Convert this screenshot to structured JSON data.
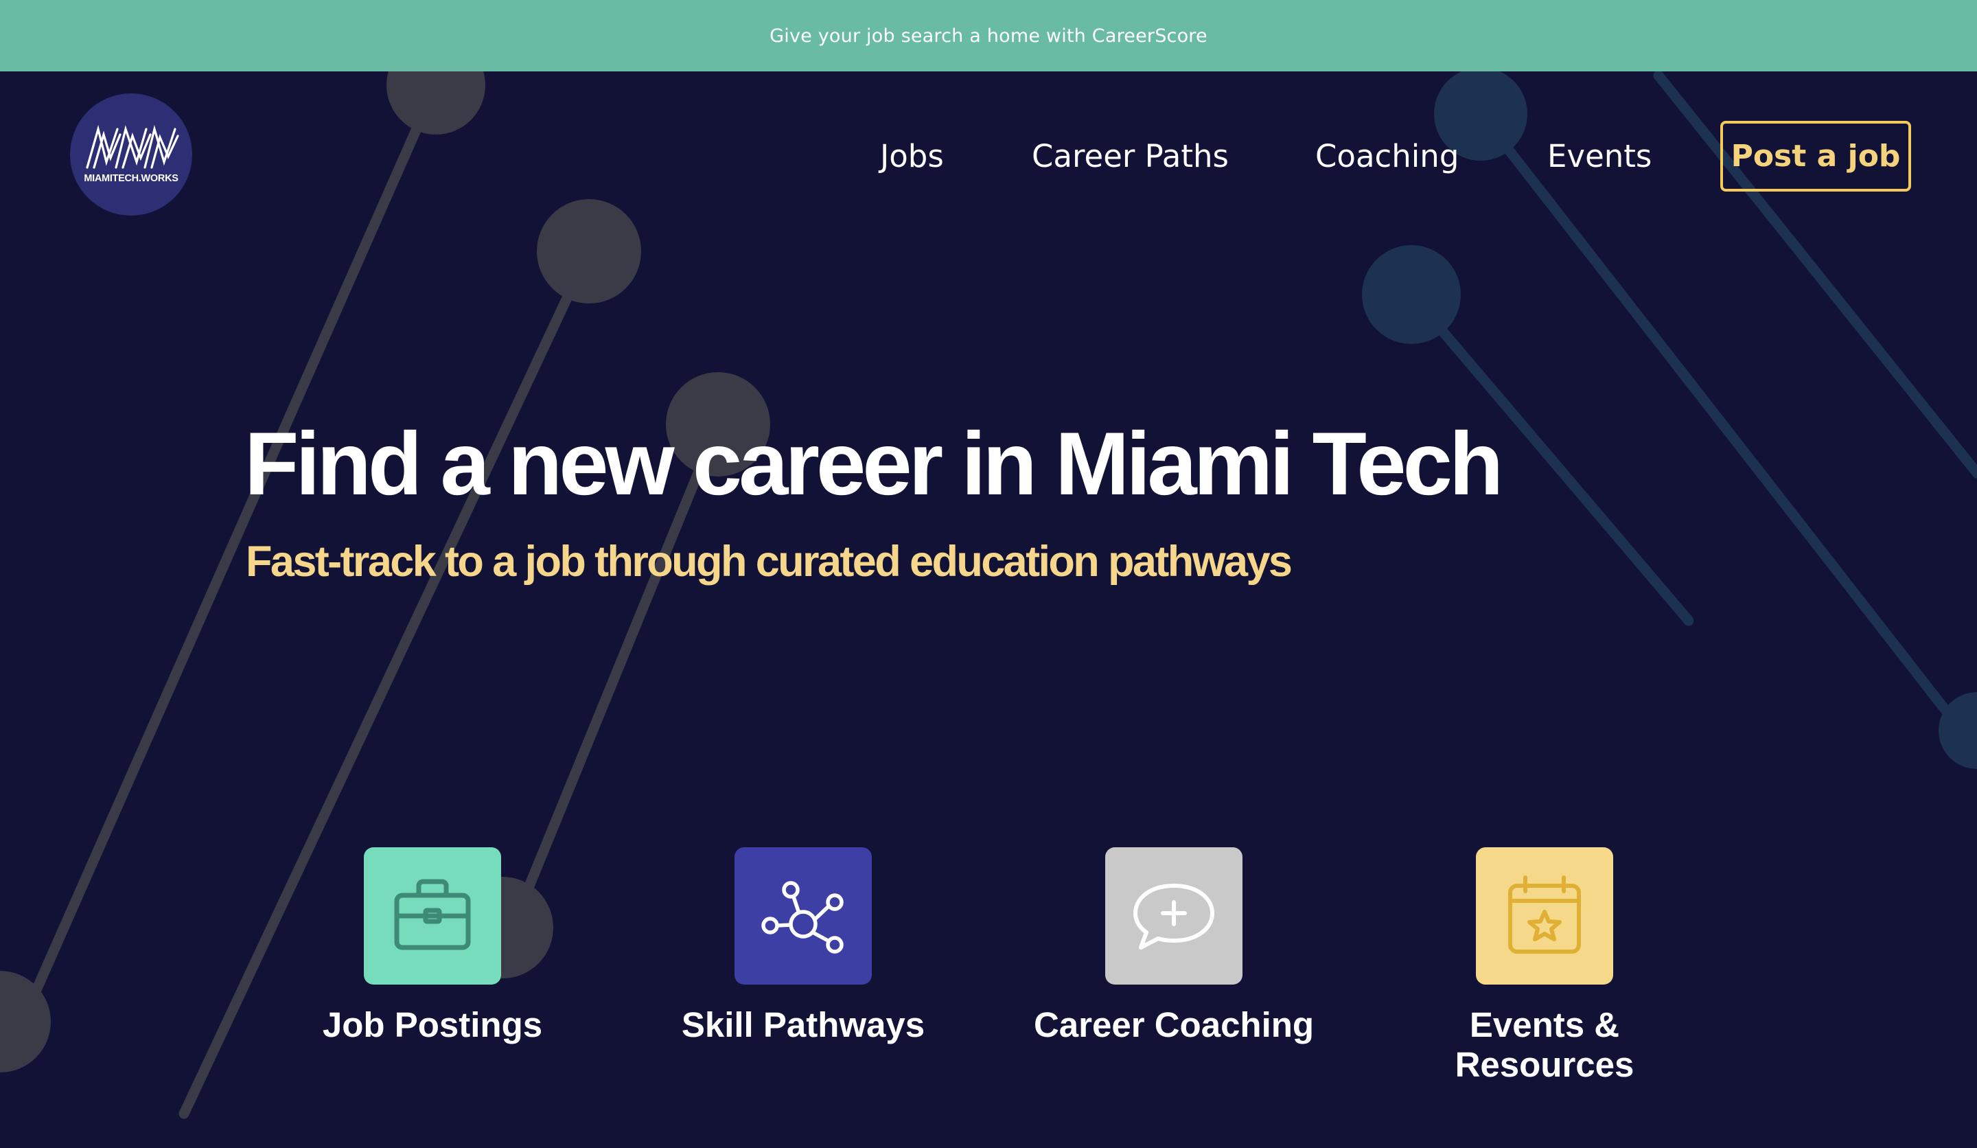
{
  "banner": {
    "text": "Give your job search a home with CareerScore"
  },
  "logo": {
    "text": "MIAMITECH.WORKS"
  },
  "nav": {
    "items": [
      {
        "label": "Jobs"
      },
      {
        "label": "Career Paths"
      },
      {
        "label": "Coaching"
      },
      {
        "label": "Events"
      }
    ],
    "cta_label": "Post a job"
  },
  "hero": {
    "title": "Find a new career in Miami Tech",
    "subtitle": "Fast-track to a job through curated education pathways"
  },
  "cards": [
    {
      "label": "Job Postings",
      "icon": "briefcase-icon",
      "color": "#76dcbc"
    },
    {
      "label": "Skill Pathways",
      "icon": "network-icon",
      "color": "#3e3fa4"
    },
    {
      "label": "Career Coaching",
      "icon": "chat-plus-icon",
      "color": "#c9c9c9"
    },
    {
      "label": "Events & Resources",
      "icon": "calendar-star-icon",
      "color": "#f6d88a"
    }
  ],
  "colors": {
    "banner_bg": "#69bba3",
    "page_bg": "#111236",
    "accent_yellow": "#f5c95a",
    "subtitle_yellow": "#f6d68a",
    "logo_bg": "#2e2e74"
  }
}
